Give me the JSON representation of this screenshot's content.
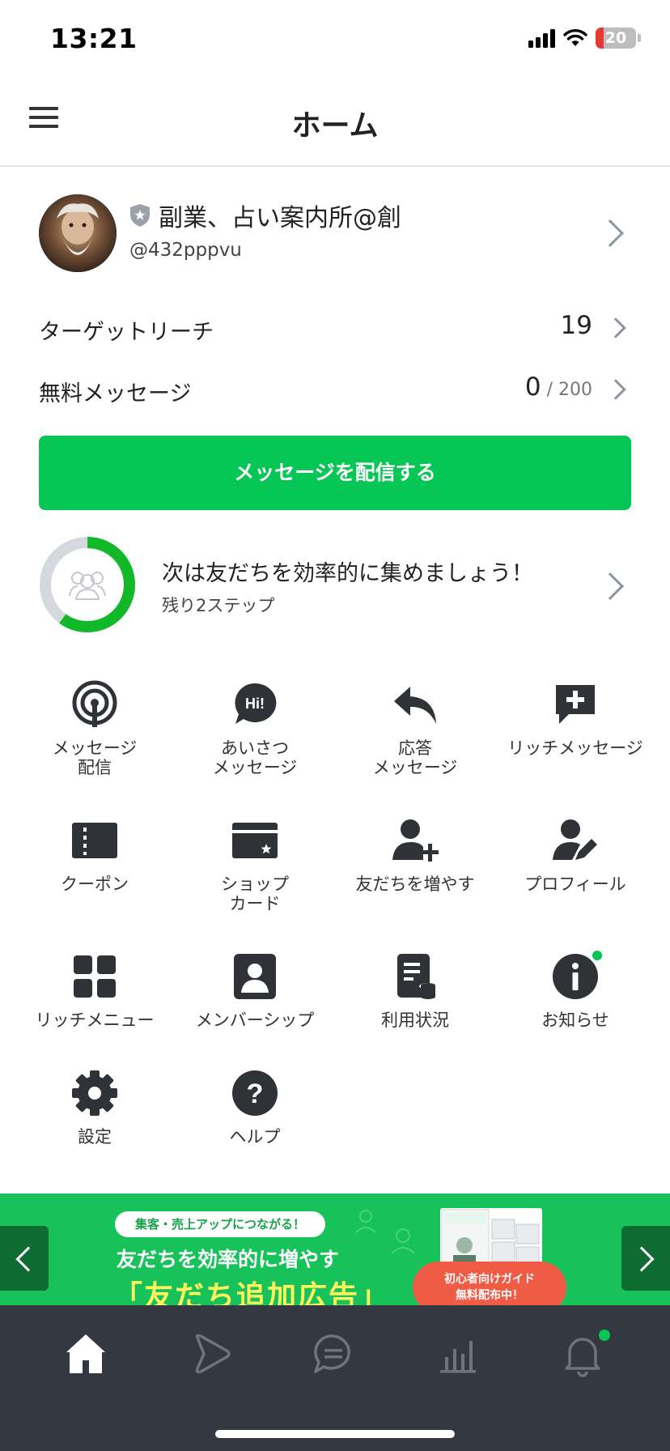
{
  "status_bar": {
    "time": "13:21",
    "battery": "20",
    "battery_level": 0.2
  },
  "header": {
    "title": "ホーム"
  },
  "account": {
    "name": "副業、占い案内所@創",
    "id": "@432pppvu"
  },
  "stats": [
    {
      "label": "ターゲットリーチ",
      "value": "19",
      "sub": ""
    },
    {
      "label": "無料メッセージ",
      "value": "0",
      "sub": " / 200"
    }
  ],
  "cta": {
    "label": "メッセージを配信する"
  },
  "progress": {
    "title": "次は友だちを効率的に集めましょう！",
    "subtitle": "残り2ステップ",
    "completion": 0.6
  },
  "grid": [
    {
      "label": "メッセージ\n配信",
      "icon": "broadcast-icon"
    },
    {
      "label": "あいさつ\nメッセージ",
      "icon": "greeting-hi-icon"
    },
    {
      "label": "応答\nメッセージ",
      "icon": "reply-icon"
    },
    {
      "label": "リッチメッセージ",
      "icon": "rich-message-icon"
    },
    {
      "label": "クーポン",
      "icon": "coupon-icon"
    },
    {
      "label": "ショップ\nカード",
      "icon": "shop-card-icon"
    },
    {
      "label": "友だちを増やす",
      "icon": "add-friend-icon"
    },
    {
      "label": "プロフィール",
      "icon": "profile-edit-icon"
    },
    {
      "label": "リッチメニュー",
      "icon": "rich-menu-icon"
    },
    {
      "label": "メンバーシップ",
      "icon": "membership-icon"
    },
    {
      "label": "利用状況",
      "icon": "usage-icon"
    },
    {
      "label": "お知らせ",
      "icon": "info-icon"
    },
    {
      "label": "設定",
      "icon": "settings-gear-icon"
    },
    {
      "label": "ヘルプ",
      "icon": "help-icon"
    }
  ],
  "banner": {
    "pill": "集客・売上アップにつながる！",
    "line1": "友だちを効率的に増やす",
    "line2": "「友だち追加広告」",
    "badge_line1": "初心者向けガイド",
    "badge_line2": "無料配布中！"
  },
  "tabbar": [
    {
      "name": "home",
      "icon": "home-icon",
      "active": true
    },
    {
      "name": "voom",
      "icon": "play-icon",
      "active": false
    },
    {
      "name": "chat",
      "icon": "chat-icon",
      "active": false
    },
    {
      "name": "analytics",
      "icon": "bar-chart-icon",
      "active": false
    },
    {
      "name": "notifications",
      "icon": "bell-icon",
      "active": false
    }
  ],
  "colors": {
    "brand_green": "#06c755",
    "icon_dark": "#2f3236",
    "tabbar_bg": "#343840",
    "notification_dot": "#06c755"
  }
}
